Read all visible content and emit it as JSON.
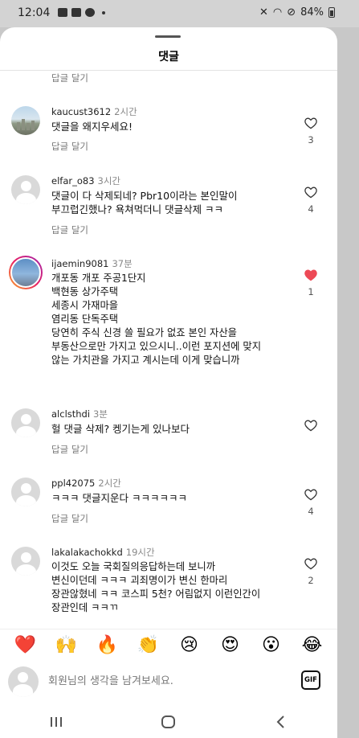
{
  "status": {
    "time": "12:04",
    "battery": "84%"
  },
  "sheet": {
    "title": "댓글"
  },
  "top_reply": "답글 달기",
  "comments": [
    {
      "user": "kaucust3612",
      "ago": "2시간",
      "text": "댓글을 왜지우세요!",
      "reply": "답글 달기",
      "likes": "3",
      "liked": false
    },
    {
      "user": "elfar_o83",
      "ago": "3시간",
      "text": "댓글이 다 삭제되네? Pbr10이라는 본인말이\n부끄럽긴했나? 욕쳐먹더니 댓글삭제 ㅋㅋ",
      "reply": "답글 달기",
      "likes": "4",
      "liked": false
    },
    {
      "user": "ijaemin9081",
      "ago": "37분",
      "text": "개포동 개포 주공1단지\n백현동 상가주택\n세종시 가재마을\n염리동 단독주택\n당연히 주식 신경 쓸 필요가 없죠 본인 자산을\n부동산으로만 가지고 있으시니..이런 포지션에 맞지\n않는 가치관을 가지고 계시는데 이게 맞습니까",
      "reply": "",
      "likes": "1",
      "liked": true
    },
    {
      "user": "alclsthdi",
      "ago": "3분",
      "text": "헐 댓글 삭제? 켕기는게 있나보다",
      "reply": "답글 달기",
      "likes": "",
      "liked": false
    },
    {
      "user": "ppl42075",
      "ago": "2시간",
      "text": "ㅋㅋㅋ 댓글지운다 ㅋㅋㅋㅋㅋㅋ",
      "reply": "답글 달기",
      "likes": "4",
      "liked": false
    },
    {
      "user": "lakalakachokkd",
      "ago": "19시간",
      "text": "이것도 오늘 국회질의응답하는데 보니까\n변신이던데 ㅋㅋㅋ  괴죄명이가 변신 한마리\n장관않혔네 ㅋㅋ 코스피 5천? 어림없지 이런인간이\n장관인데 ㅋㅋㄲ",
      "reply": "",
      "likes": "2",
      "liked": false
    }
  ],
  "emojis": [
    "❤️",
    "🙌",
    "🔥",
    "👏",
    "😢",
    "😍",
    "😮",
    "😂"
  ],
  "input": {
    "placeholder": "회원님의 생각을 남겨보세요.",
    "gif_label": "GIF"
  },
  "colors": {
    "liked_heart": "#ed4956",
    "sheet_bg": "#ffffff",
    "backdrop": "#c8c8c8"
  }
}
